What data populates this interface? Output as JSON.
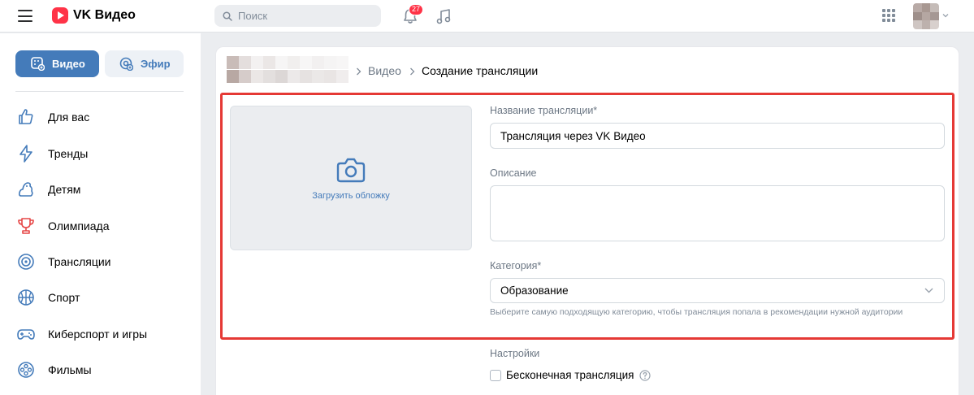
{
  "header": {
    "logo_text": "VK Видео",
    "search_placeholder": "Поиск",
    "notifications_count": "27"
  },
  "sidebar": {
    "pills": [
      {
        "label": "Видео",
        "active": true
      },
      {
        "label": "Эфир",
        "active": false
      }
    ],
    "items": [
      {
        "label": "Для вас",
        "icon": "thumbs-up-icon"
      },
      {
        "label": "Тренды",
        "icon": "lightning-icon"
      },
      {
        "label": "Детям",
        "icon": "toy-icon"
      },
      {
        "label": "Олимпиада",
        "icon": "trophy-icon"
      },
      {
        "label": "Трансляции",
        "icon": "broadcast-icon"
      },
      {
        "label": "Спорт",
        "icon": "basketball-icon"
      },
      {
        "label": "Киберспорт и игры",
        "icon": "gamepad-icon"
      },
      {
        "label": "Фильмы",
        "icon": "film-reel-icon"
      }
    ]
  },
  "breadcrumb": {
    "items": [
      "Видео",
      "Создание трансляции"
    ]
  },
  "form": {
    "cover_label": "Загрузить обложку",
    "title_label": "Название трансляции*",
    "title_value": "Трансляция через VK Видео",
    "description_label": "Описание",
    "description_value": "",
    "category_label": "Категория*",
    "category_value": "Образование",
    "category_hint": "Выберите самую подходящую категорию, чтобы трансляция попала в рекомендации нужной аудитории",
    "settings_label": "Настройки",
    "endless_label": "Бесконечная трансляция",
    "endless_checked": false
  },
  "colors": {
    "accent": "#447bba",
    "badge": "#ff3347",
    "highlight_frame": "#e53935"
  }
}
